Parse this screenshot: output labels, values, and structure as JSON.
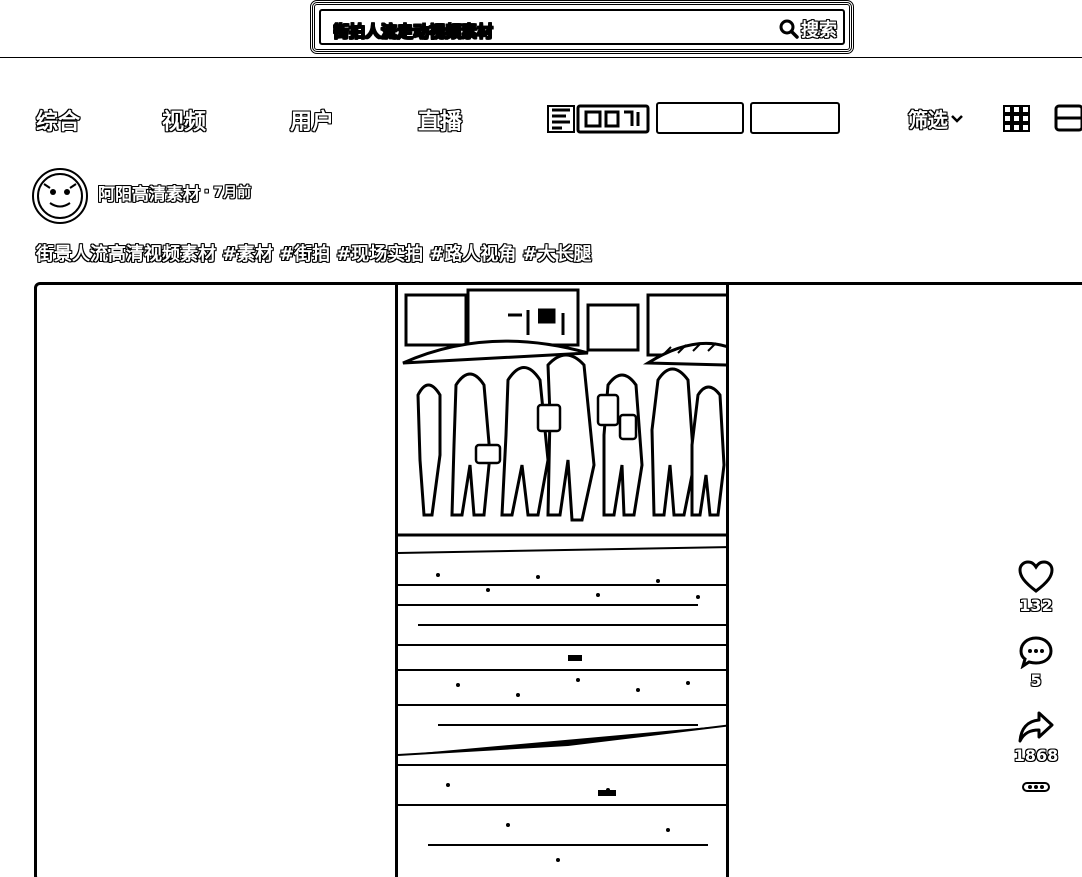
{
  "search": {
    "value": "街拍人流走动视频素材",
    "button_label": "搜索"
  },
  "tabs": [
    {
      "label": "综合"
    },
    {
      "label": "视频"
    },
    {
      "label": "用户"
    },
    {
      "label": "直播"
    }
  ],
  "filter_pills": [
    "",
    ""
  ],
  "toolbar": {
    "filter_label": "筛选"
  },
  "post": {
    "author": "阿阳高清素材",
    "separator": "·",
    "time": "7月前",
    "description": "街景人流高清视频素材",
    "tags": [
      "#素材",
      "#街拍",
      "#现场实拍",
      "#路人视角",
      "#大长腿"
    ],
    "likes": "132",
    "comments": "5",
    "shares": "1868"
  },
  "icons": {
    "search": "search-icon",
    "brand": "brand-logo-icon",
    "filter": "chevron-down-icon",
    "grid": "grid-view-icon",
    "list": "list-view-icon",
    "like": "heart-icon",
    "comment": "comment-icon",
    "share": "share-icon",
    "more": "more-icon"
  },
  "colors": {
    "foreground": "#000000",
    "background": "#ffffff"
  }
}
